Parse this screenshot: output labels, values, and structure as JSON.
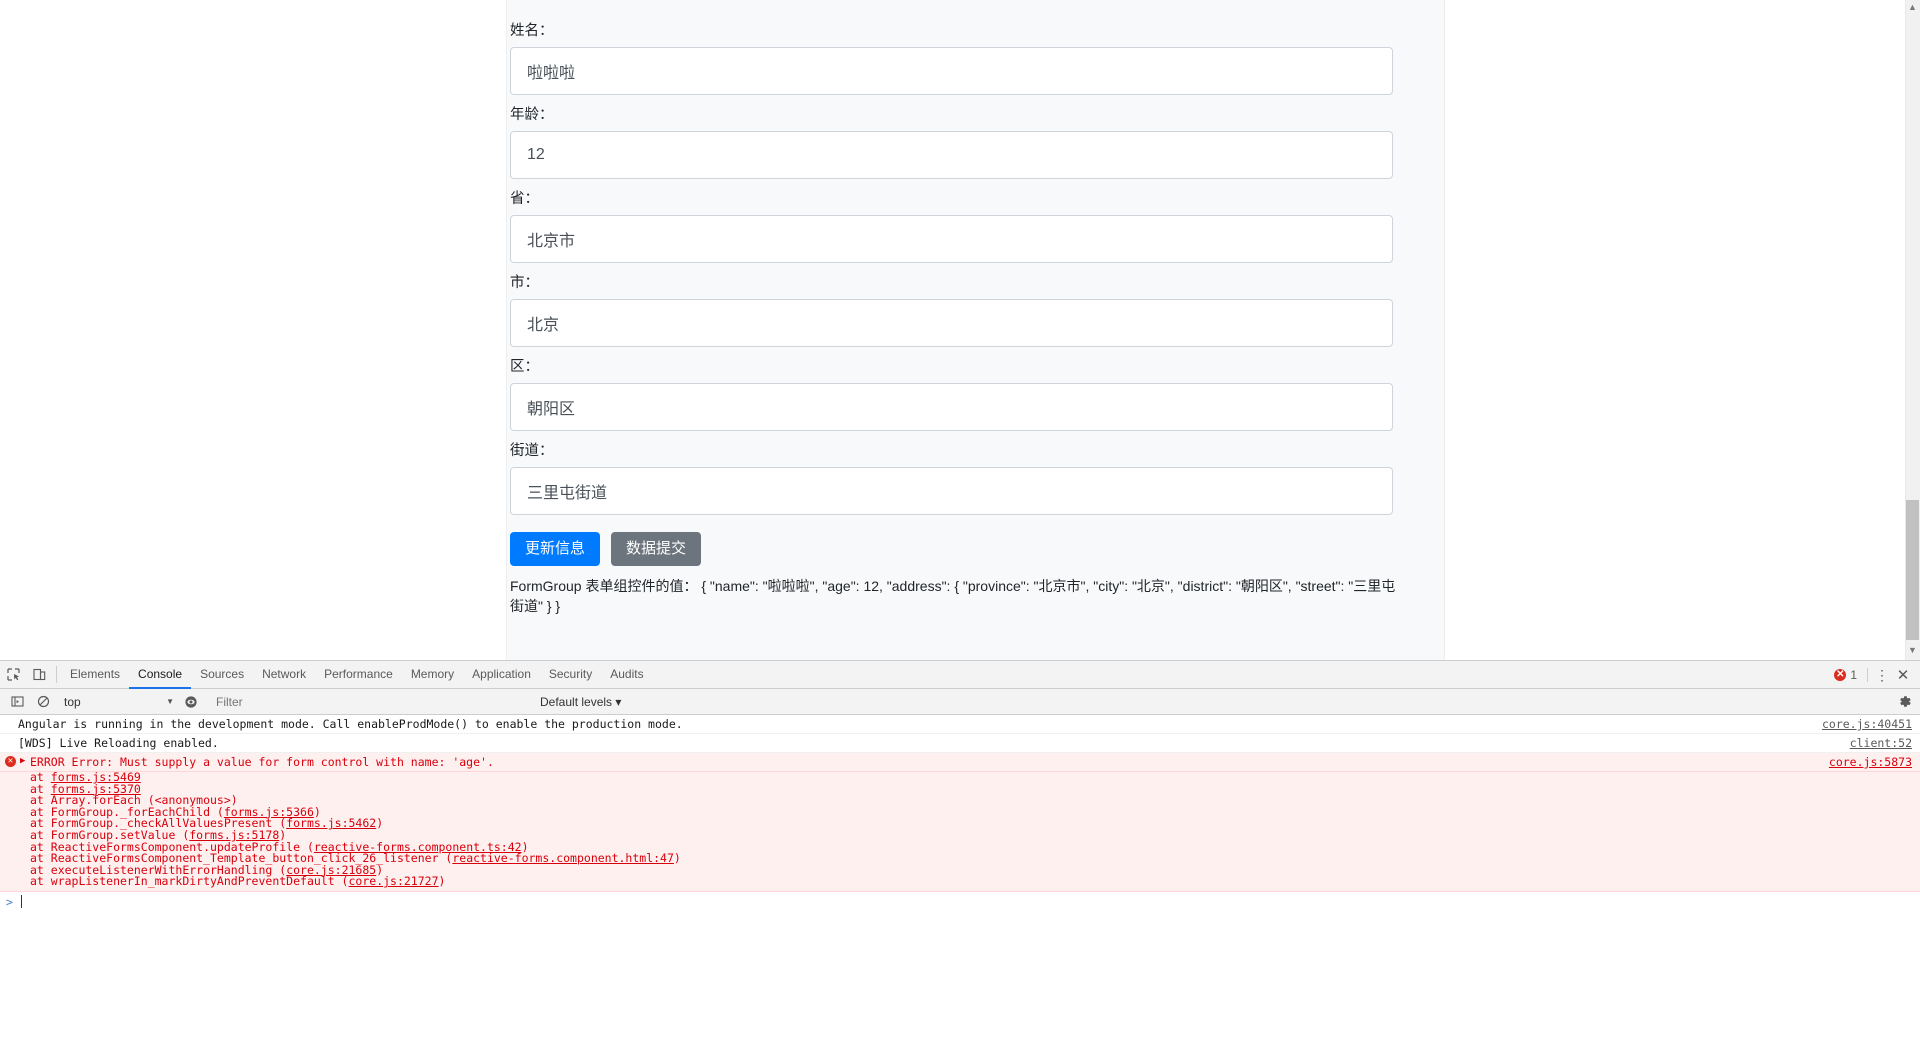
{
  "page": {
    "form": {
      "fields": [
        {
          "label": "姓名：",
          "value": "啦啦啦",
          "name": "name"
        },
        {
          "label": "年龄：",
          "value": "12",
          "name": "age"
        },
        {
          "label": "省：",
          "value": "北京市",
          "name": "province"
        },
        {
          "label": "市：",
          "value": "北京",
          "name": "city"
        },
        {
          "label": "区：",
          "value": "朝阳区",
          "name": "district"
        },
        {
          "label": "街道：",
          "value": "三里屯街道",
          "name": "street"
        }
      ],
      "buttons": {
        "update": "更新信息",
        "submit": "数据提交"
      },
      "formgroup_dump": "FormGroup 表单组控件的值： { \"name\": \"啦啦啦\", \"age\": 12, \"address\": { \"province\": \"北京市\", \"city\": \"北京\", \"district\": \"朝阳区\", \"street\": \"三里屯街道\" } }"
    },
    "colors": {
      "primary": "#007bff",
      "secondary": "#6c757d",
      "error": "#d8000c",
      "form_bg": "#f8f9fa"
    }
  },
  "devtools": {
    "tabs": [
      {
        "label": "Elements",
        "active": false
      },
      {
        "label": "Console",
        "active": true
      },
      {
        "label": "Sources",
        "active": false
      },
      {
        "label": "Network",
        "active": false
      },
      {
        "label": "Performance",
        "active": false
      },
      {
        "label": "Memory",
        "active": false
      },
      {
        "label": "Application",
        "active": false
      },
      {
        "label": "Security",
        "active": false
      },
      {
        "label": "Audits",
        "active": false
      }
    ],
    "error_count": "1",
    "filterbar": {
      "context": "top",
      "filter_placeholder": "Filter",
      "levels": "Default levels ▾"
    },
    "console": {
      "messages": [
        {
          "text": "Angular is running in the development mode. Call enableProdMode() to enable the production mode.",
          "source": "core.js:40451",
          "type": "log"
        },
        {
          "text": "[WDS] Live Reloading enabled.",
          "source": "client:52",
          "type": "log"
        }
      ],
      "error": {
        "text": "ERROR Error: Must supply a value for form control with name: 'age'.",
        "source": "core.js:5873",
        "stack": [
          {
            "fn": "at ",
            "link": "forms.js:5469",
            "tail": ""
          },
          {
            "fn": "at ",
            "link": "forms.js:5370",
            "tail": ""
          },
          {
            "fn": "at Array.forEach (<anonymous>)",
            "link": "",
            "tail": ""
          },
          {
            "fn": "at FormGroup._forEachChild (",
            "link": "forms.js:5366",
            "tail": ")"
          },
          {
            "fn": "at FormGroup._checkAllValuesPresent (",
            "link": "forms.js:5462",
            "tail": ")"
          },
          {
            "fn": "at FormGroup.setValue (",
            "link": "forms.js:5178",
            "tail": ")"
          },
          {
            "fn": "at ReactiveFormsComponent.updateProfile (",
            "link": "reactive-forms.component.ts:42",
            "tail": ")"
          },
          {
            "fn": "at ReactiveFormsComponent_Template_button_click_26_listener (",
            "link": "reactive-forms.component.html:47",
            "tail": ")"
          },
          {
            "fn": "at executeListenerWithErrorHandling (",
            "link": "core.js:21685",
            "tail": ")"
          },
          {
            "fn": "at wrapListenerIn_markDirtyAndPreventDefault (",
            "link": "core.js:21727",
            "tail": ")"
          }
        ]
      },
      "prompt": ">"
    }
  }
}
